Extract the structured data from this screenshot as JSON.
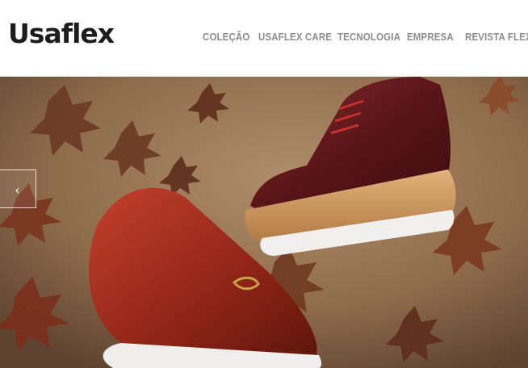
{
  "header": {
    "logo_text": "Usaflex",
    "nav": [
      {
        "label": "COLEÇÃO"
      },
      {
        "label": "USAFLEX CARE"
      },
      {
        "label": "TECNOLOGIA"
      },
      {
        "label": "EMPRESA"
      },
      {
        "label": "REVISTA FLEX"
      }
    ]
  },
  "hero": {
    "prev_icon": "‹",
    "colors": {
      "background": "#8a6a4a",
      "leaf": "#6b3a24",
      "oxford": "#6e1f22",
      "loafer": "#a02a1c",
      "sole_wood": "#d4a06a"
    }
  }
}
